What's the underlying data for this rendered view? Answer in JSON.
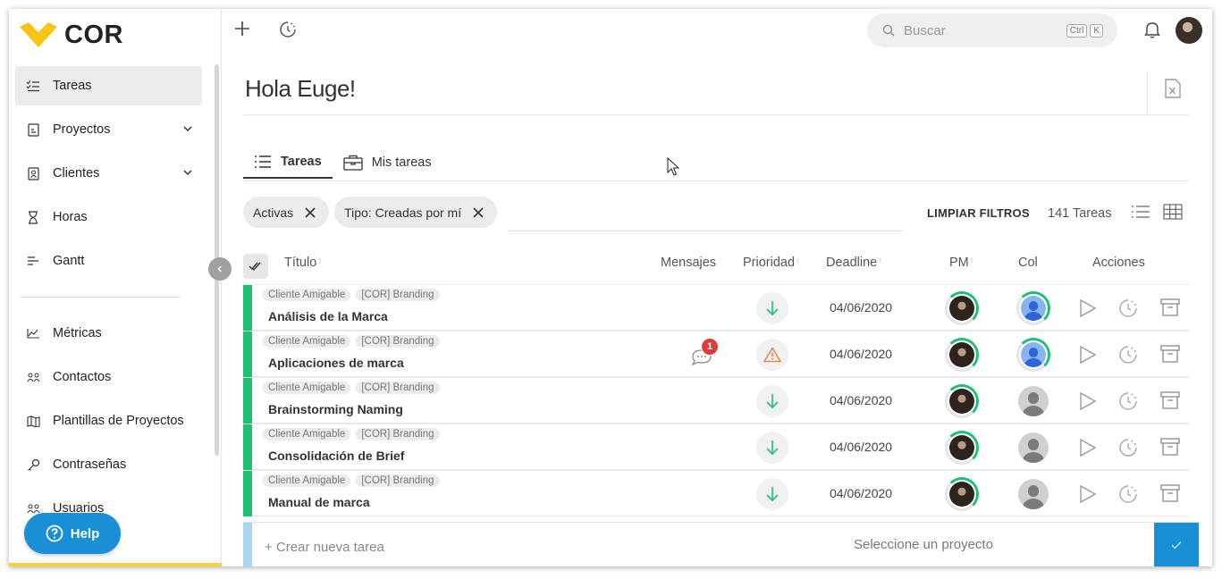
{
  "brand": {
    "name": "COR",
    "logo_color": "#f5c518"
  },
  "sidebar": {
    "items": [
      {
        "label": "Tareas",
        "icon": "task-list-icon",
        "active": true
      },
      {
        "label": "Proyectos",
        "icon": "project-icon",
        "expandable": true
      },
      {
        "label": "Clientes",
        "icon": "client-icon",
        "expandable": true
      },
      {
        "label": "Horas",
        "icon": "hourglass-icon"
      },
      {
        "label": "Gantt",
        "icon": "gantt-icon"
      },
      {
        "label": "Métricas",
        "icon": "metrics-icon"
      },
      {
        "label": "Contactos",
        "icon": "contacts-icon"
      },
      {
        "label": "Plantillas de Proyectos",
        "icon": "map-icon"
      },
      {
        "label": "Contraseñas",
        "icon": "key-icon"
      },
      {
        "label": "Usuarios",
        "icon": "users-icon"
      }
    ],
    "help_label": "Help"
  },
  "topbar": {
    "search_placeholder": "Buscar",
    "shortcut_keys": [
      "Ctrl",
      "K"
    ]
  },
  "main": {
    "greeting": "Hola Euge!",
    "tabs": [
      {
        "label": "Tareas",
        "active": true
      },
      {
        "label": "Mis tareas",
        "active": false
      }
    ],
    "filters": [
      {
        "label": "Activas"
      },
      {
        "label": "Tipo: Creadas por mí"
      }
    ],
    "clear_filters": "LIMPIAR FILTROS",
    "task_count": "141 Tareas",
    "columns": {
      "title": "Título",
      "messages": "Mensajes",
      "priority": "Prioridad",
      "deadline": "Deadline",
      "pm": "PM",
      "col": "Col",
      "actions": "Acciones"
    },
    "tasks": [
      {
        "client": "Cliente Amigable",
        "project": "[COR] Branding",
        "title": "Análisis de la Marca",
        "messages": "",
        "priority": "low",
        "deadline": "04/06/2020",
        "collaborator": "blue"
      },
      {
        "client": "Cliente Amigable",
        "project": "[COR] Branding",
        "title": "Aplicaciones de marca",
        "messages": "1",
        "priority": "warning",
        "deadline": "04/06/2020",
        "collaborator": "blue"
      },
      {
        "client": "Cliente Amigable",
        "project": "[COR] Branding",
        "title": "Brainstorming Naming",
        "messages": "",
        "priority": "low",
        "deadline": "04/06/2020",
        "collaborator": "grey"
      },
      {
        "client": "Cliente Amigable",
        "project": "[COR] Branding",
        "title": "Consolidación de Brief",
        "messages": "",
        "priority": "low",
        "deadline": "04/06/2020",
        "collaborator": "grey"
      },
      {
        "client": "Cliente Amigable",
        "project": "[COR] Branding",
        "title": "Manual de marca",
        "messages": "",
        "priority": "low",
        "deadline": "04/06/2020",
        "collaborator": "grey"
      }
    ],
    "new_task": {
      "placeholder": "+ Crear nueva tarea",
      "project_placeholder": "Seleccione un proyecto"
    }
  },
  "colors": {
    "accent": "#1a8fd6",
    "status_green": "#1ec174",
    "badge_red": "#e03b3b",
    "warning": "#e07a3a"
  }
}
